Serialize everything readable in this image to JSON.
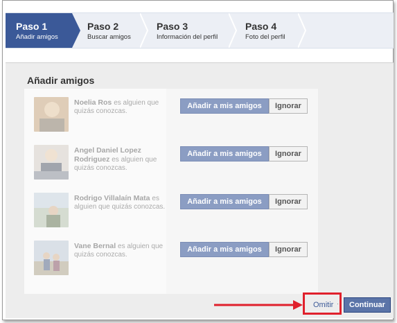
{
  "steps": [
    {
      "num": "Paso 1",
      "label": "Añadir amigos"
    },
    {
      "num": "Paso 2",
      "label": "Buscar amigos"
    },
    {
      "num": "Paso 3",
      "label": "Información del perfil"
    },
    {
      "num": "Paso 4",
      "label": "Foto del perfil"
    }
  ],
  "section_title": "Añadir amigos",
  "suggestion_text": "es alguien que quizás conozcas.",
  "friends": [
    {
      "name": "Noelia Ros"
    },
    {
      "name": "Angel Daniel Lopez Rodriguez"
    },
    {
      "name": "Rodrigo Villalaín Mata"
    },
    {
      "name": "Vane Bernal"
    }
  ],
  "buttons": {
    "add": "Añadir a mis amigos",
    "ignore": "Ignorar",
    "skip": "Omitir",
    "continue": "Continuar"
  },
  "colors": {
    "accent": "#3b5998",
    "highlight": "#e0202c"
  }
}
